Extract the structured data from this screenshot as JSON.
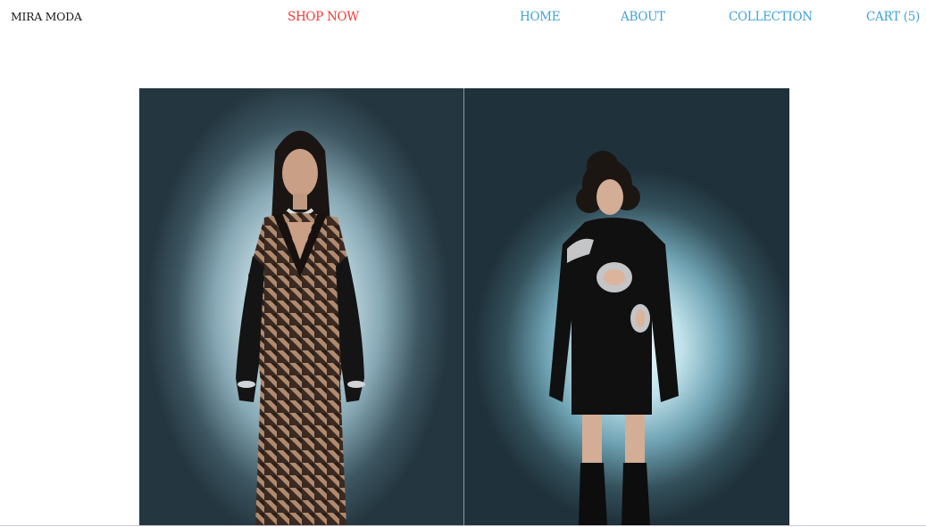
{
  "nav": {
    "logo": "MIRA MODA",
    "shop_now": "SHOP NOW",
    "home": "HOME",
    "about": "ABOUT",
    "collection": "COLLECTION",
    "cart": "CART (5)"
  },
  "colors": {
    "shop_now": "#ef3b34",
    "nav_link": "#42a2d6",
    "logo": "#1a1a1a"
  }
}
